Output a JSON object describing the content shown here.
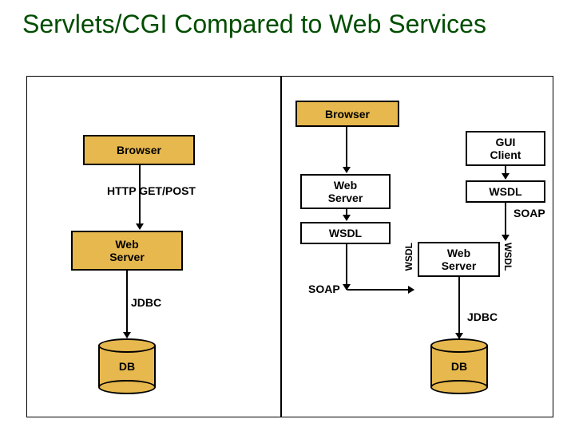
{
  "title": "Servlets/CGI Compared to Web Services",
  "left": {
    "browser": "Browser",
    "http": "HTTP GET/POST",
    "webserver": "Web\nServer",
    "jdbc": "JDBC",
    "db": "DB"
  },
  "right": {
    "browser": "Browser",
    "gui": "GUI\nClient",
    "webserver_top": "Web\nServer",
    "wsdl_top_right": "WSDL",
    "wsdl_box": "WSDL",
    "soap_top_right": "SOAP",
    "wsdl_left_v": "WSDL",
    "wsdl_right_v": "WSDL",
    "webserver_mid": "Web\nServer",
    "soap_left": "SOAP",
    "jdbc": "JDBC",
    "db": "DB"
  }
}
